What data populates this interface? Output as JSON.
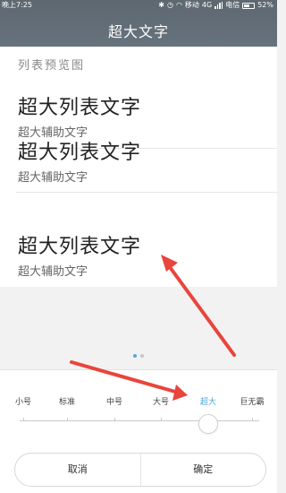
{
  "status_bar": {
    "time": "晚上7:25",
    "network_label": "移动",
    "network_type": "4G",
    "carrier": "电信",
    "battery": "52%"
  },
  "header": {
    "title": "超大文字"
  },
  "preview": {
    "label": "列表预览图",
    "items": [
      {
        "main": "超大列表文字",
        "sub": "超大辅助文字"
      },
      {
        "main": "超大列表文字",
        "sub": "超大辅助文字"
      },
      {
        "main": "超大列表文字",
        "sub": "超大辅助文字"
      }
    ]
  },
  "pager": {
    "count": 2,
    "active_index": 0
  },
  "font_size_picker": {
    "options": [
      "小号",
      "标准",
      "中号",
      "大号",
      "超大",
      "巨无霸"
    ],
    "selected_index": 4
  },
  "actions": {
    "cancel": "取消",
    "confirm": "确定"
  },
  "colors": {
    "accent": "#4ea5d9",
    "header": "#5f6a74",
    "annotation_arrow": "#e8453c"
  }
}
